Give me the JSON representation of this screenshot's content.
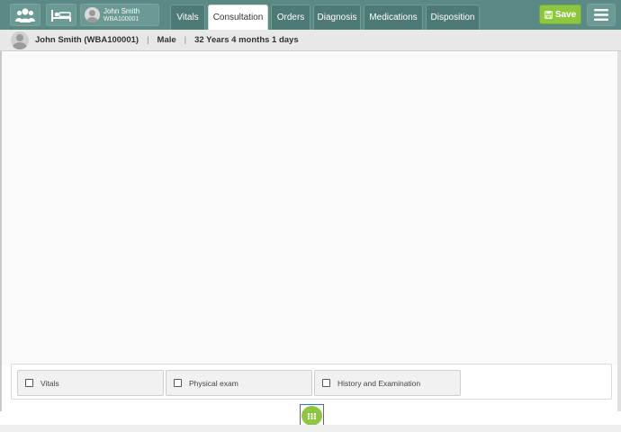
{
  "topbar": {
    "patient_chip": {
      "name": "John Smith",
      "id": "WBA100001"
    },
    "tabs": [
      {
        "label": "Vitals",
        "active": false
      },
      {
        "label": "Consultation",
        "active": true
      },
      {
        "label": "Orders",
        "active": false
      },
      {
        "label": "Diagnosis",
        "active": false
      },
      {
        "label": "Medications",
        "active": false
      },
      {
        "label": "Disposition",
        "active": false
      }
    ],
    "save_label": "Save"
  },
  "patient_header": {
    "name_id": "John Smith (WBA100001)",
    "gender": "Male",
    "age": "32 Years 4 months 1 days",
    "separator": "|"
  },
  "sections": [
    {
      "label": "Vitals",
      "checked": false
    },
    {
      "label": "Physical exam",
      "checked": false
    },
    {
      "label": "History and Examination",
      "checked": false
    }
  ],
  "colors": {
    "topbar": "#5b8a85",
    "tab_inactive": "#4e7a76",
    "accent_green": "#8dc63f",
    "focus_blue": "#2f6fd6"
  },
  "icons": {
    "patients": "users-icon",
    "beds": "bed-icon",
    "save": "floppy-disk-icon",
    "menu": "hamburger-icon",
    "fab": "grid-icon"
  }
}
